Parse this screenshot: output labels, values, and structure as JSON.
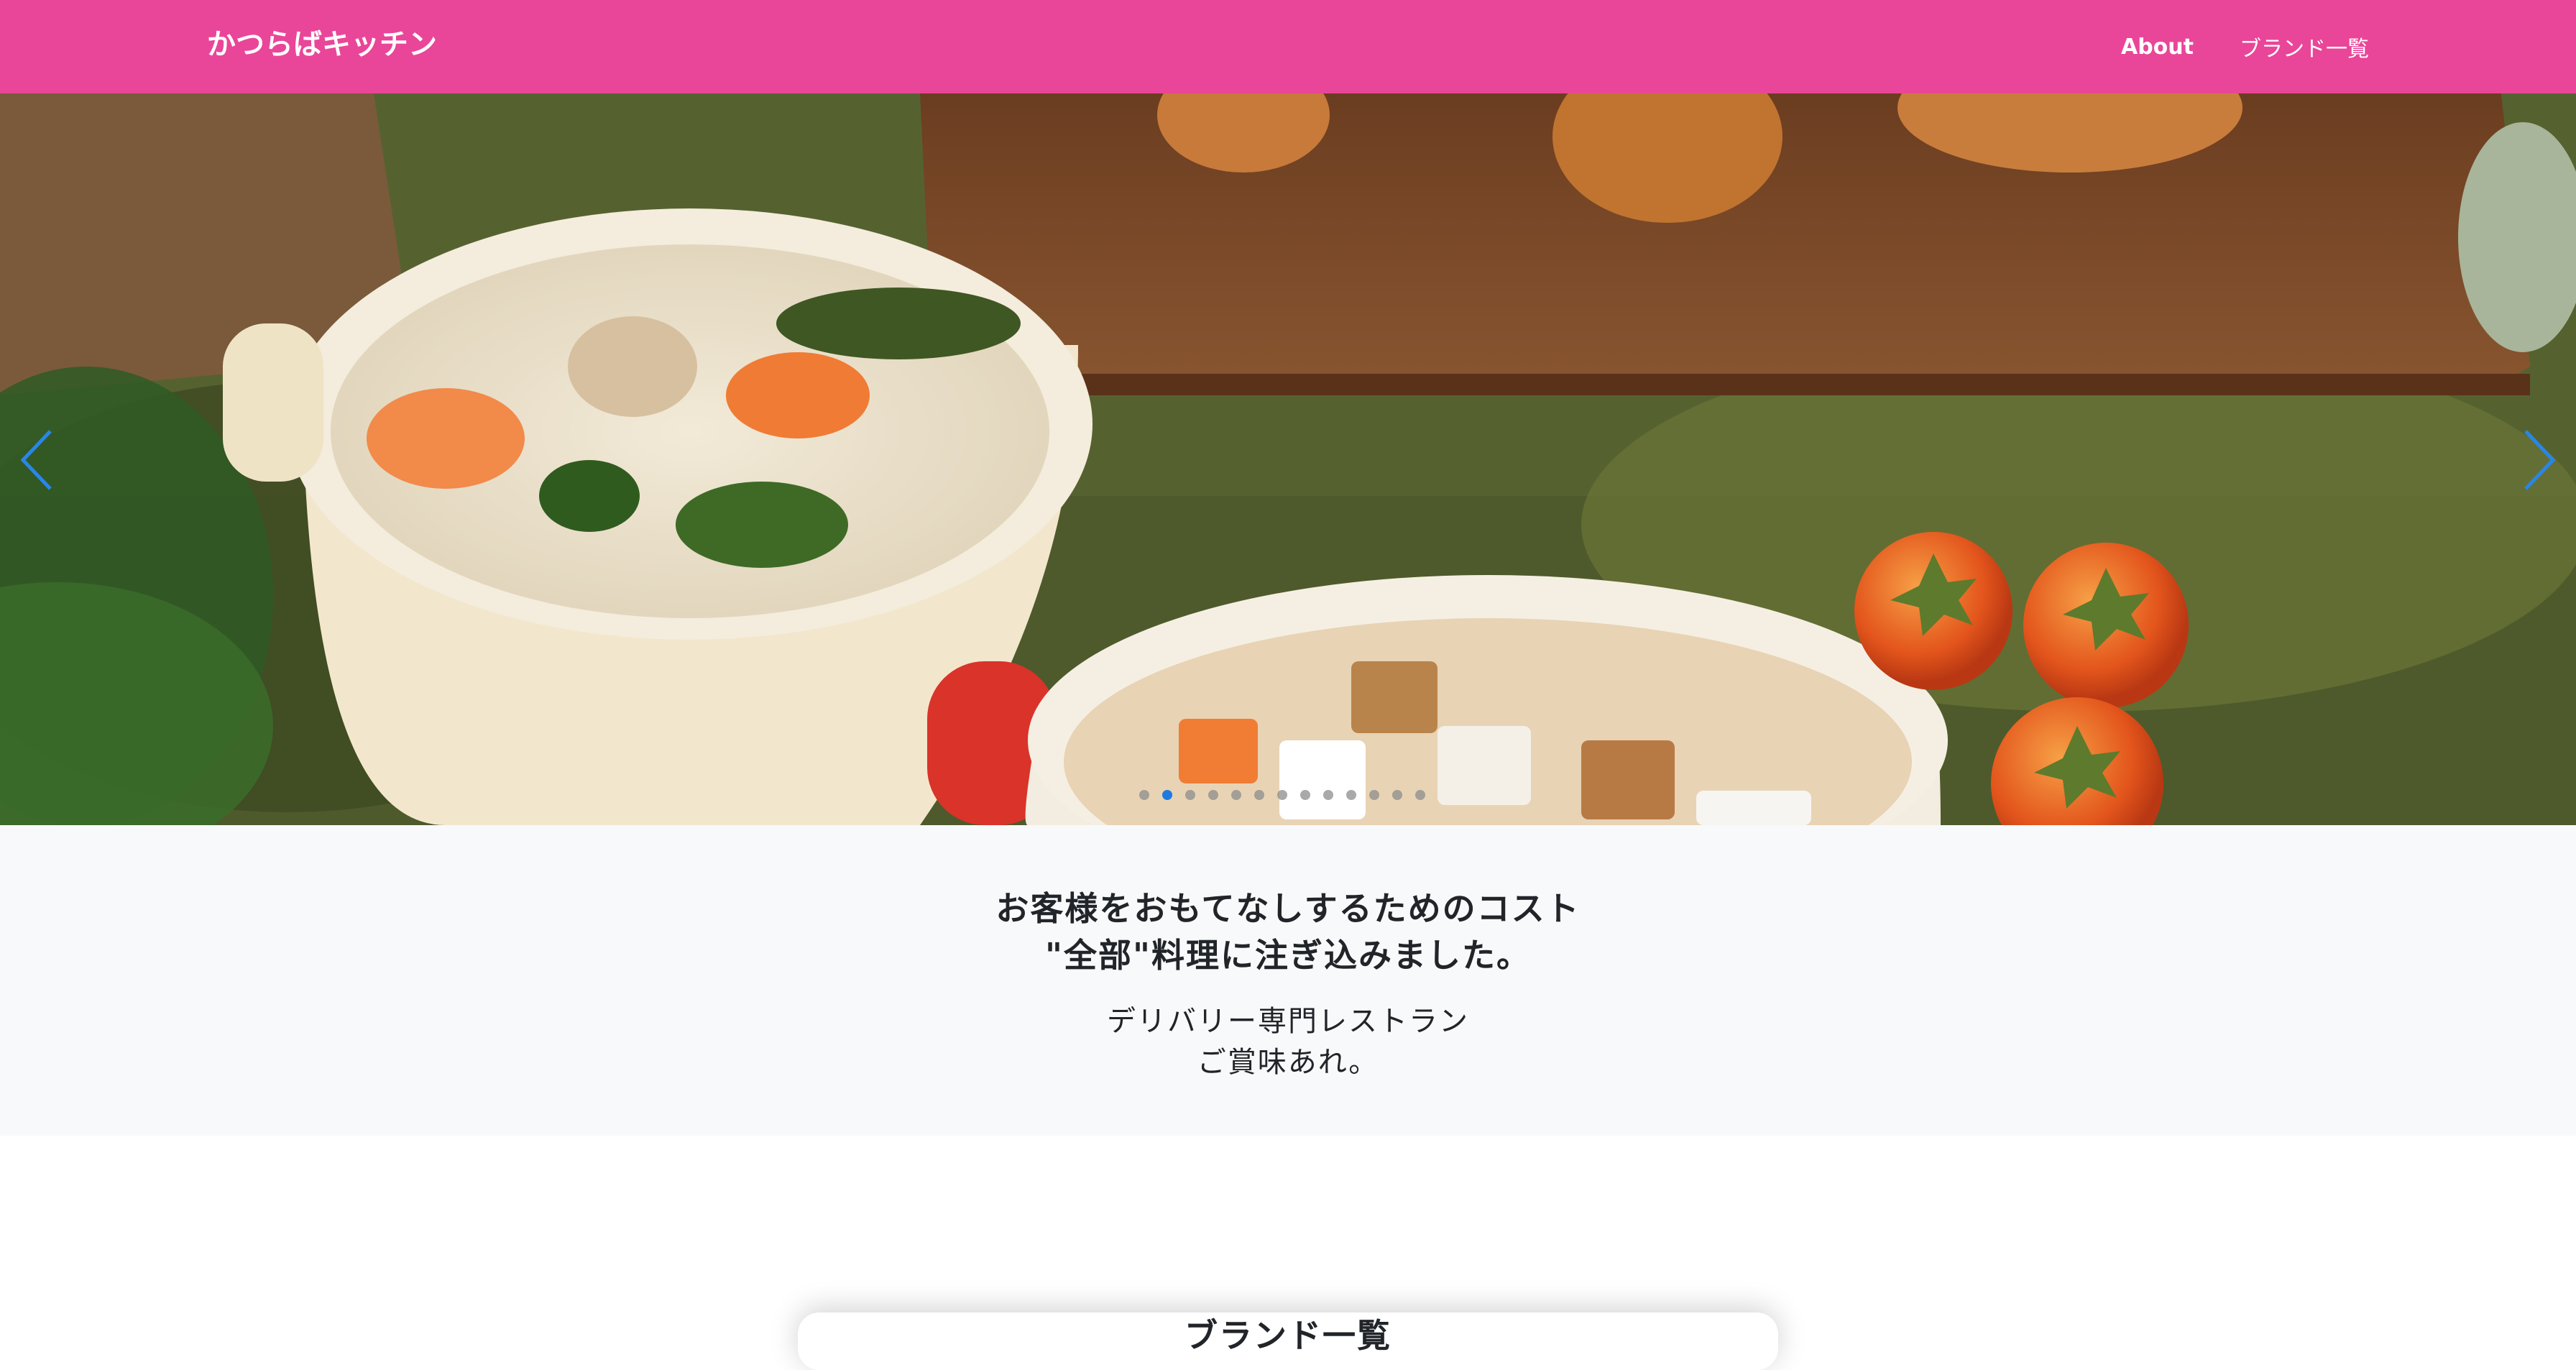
{
  "navbar": {
    "brand": "かつらばキッチン",
    "links": [
      "About",
      "ブランド一覧"
    ],
    "background": "#e94699"
  },
  "carousel": {
    "prev_icon": "chevron-left-icon",
    "next_icon": "chevron-right-icon",
    "slide_count": 13,
    "active_index": 1,
    "indicator_active_color": "#1f7ae0"
  },
  "hero": {
    "headline_line1": "お客様をおもてなしするためのコスト",
    "headline_line2": "\"全部\"料理に注ぎ込みました。",
    "sub_line1": "デリバリー専門レストラン",
    "sub_line2": "ご賞味あれ。"
  },
  "brands": {
    "title": "ブランド一覧"
  }
}
